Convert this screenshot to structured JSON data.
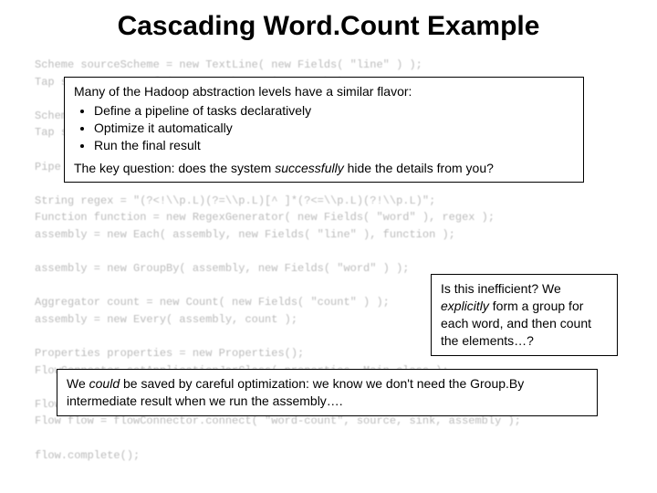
{
  "title": "Cascading Word.Count Example",
  "code": "Scheme sourceScheme = new TextLine( new Fields( \"line\" ) );\nTap source = new Hfs( sourceScheme, inputPath );\n\nScheme sinkScheme = new TextLine( new Fields( \"word\", \"count\" ) );\nTap sink = new Hfs( sinkScheme, outputPath, SinkMode.REPLACE );\n\nPipe assembly = new Pipe( \"wordcount\" );\n\nString regex = \"(?<!\\\\p.L)(?=\\\\p.L)[^ ]*(?<=\\\\p.L)(?!\\\\p.L)\";\nFunction function = new RegexGenerator( new Fields( \"word\" ), regex );\nassembly = new Each( assembly, new Fields( \"line\" ), function );\n\nassembly = new GroupBy( assembly, new Fields( \"word\" ) );\n\nAggregator count = new Count( new Fields( \"count\" ) );\nassembly = new Every( assembly, count );\n\nProperties properties = new Properties();\nFlowConnector.setApplicationJarClass( properties, Main.class );\n\nFlowConnector flowConnector = new FlowConnector( properties );\nFlow flow = flowConnector.connect( \"word-count\", source, sink, assembly );\n\nflow.complete();",
  "callout1": {
    "intro": "Many of the Hadoop abstraction levels have a similar flavor:",
    "b1": "Define a pipeline of tasks declaratively",
    "b2": "Optimize it automatically",
    "b3": "Run the final result",
    "key_pre": "The key question: does the system ",
    "key_em": "successfully",
    "key_post": " hide the details from you?"
  },
  "callout2": {
    "l1_pre": "Is this inefficient? We ",
    "l1_em": "explicitly",
    "l1_post": " form a group for each word, and then count the elements…?"
  },
  "callout3": {
    "pre": "We ",
    "em": "could",
    "post": " be saved by careful optimization: we know we don't need the Group.By intermediate result when we run the assembly…."
  }
}
